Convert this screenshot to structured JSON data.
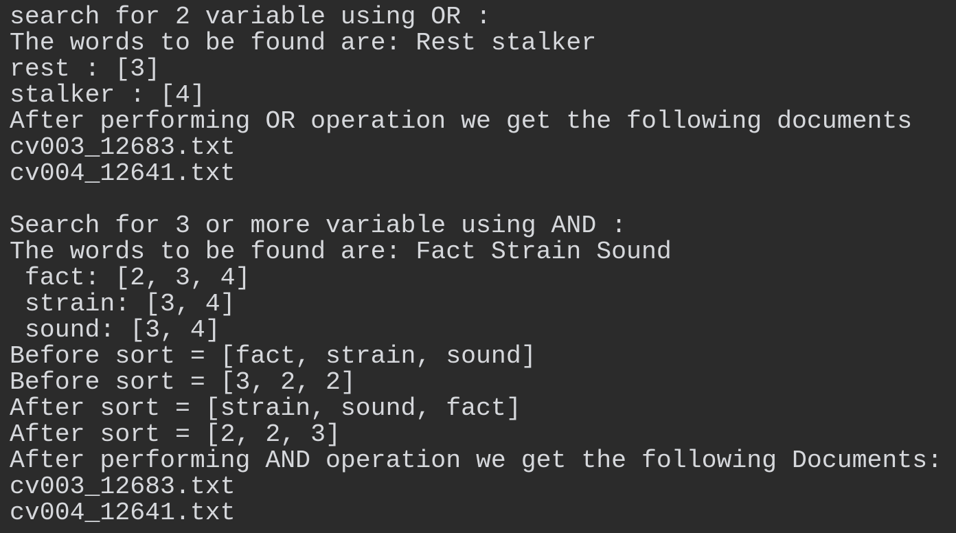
{
  "console": {
    "lines": [
      "search for 2 variable using OR :",
      "The words to be found are: Rest stalker",
      "rest : [3]",
      "stalker : [4]",
      "After performing OR operation we get the following documents",
      "cv003_12683.txt",
      "cv004_12641.txt",
      "",
      "Search for 3 or more variable using AND :",
      "The words to be found are: Fact Strain Sound",
      " fact: [2, 3, 4]",
      " strain: [3, 4]",
      " sound: [3, 4]",
      "Before sort = [fact, strain, sound]",
      "Before sort = [3, 2, 2]",
      "After sort = [strain, sound, fact]",
      "After sort = [2, 2, 3]",
      "After performing AND operation we get the following Documents:",
      "cv003_12683.txt",
      "cv004_12641.txt"
    ]
  }
}
